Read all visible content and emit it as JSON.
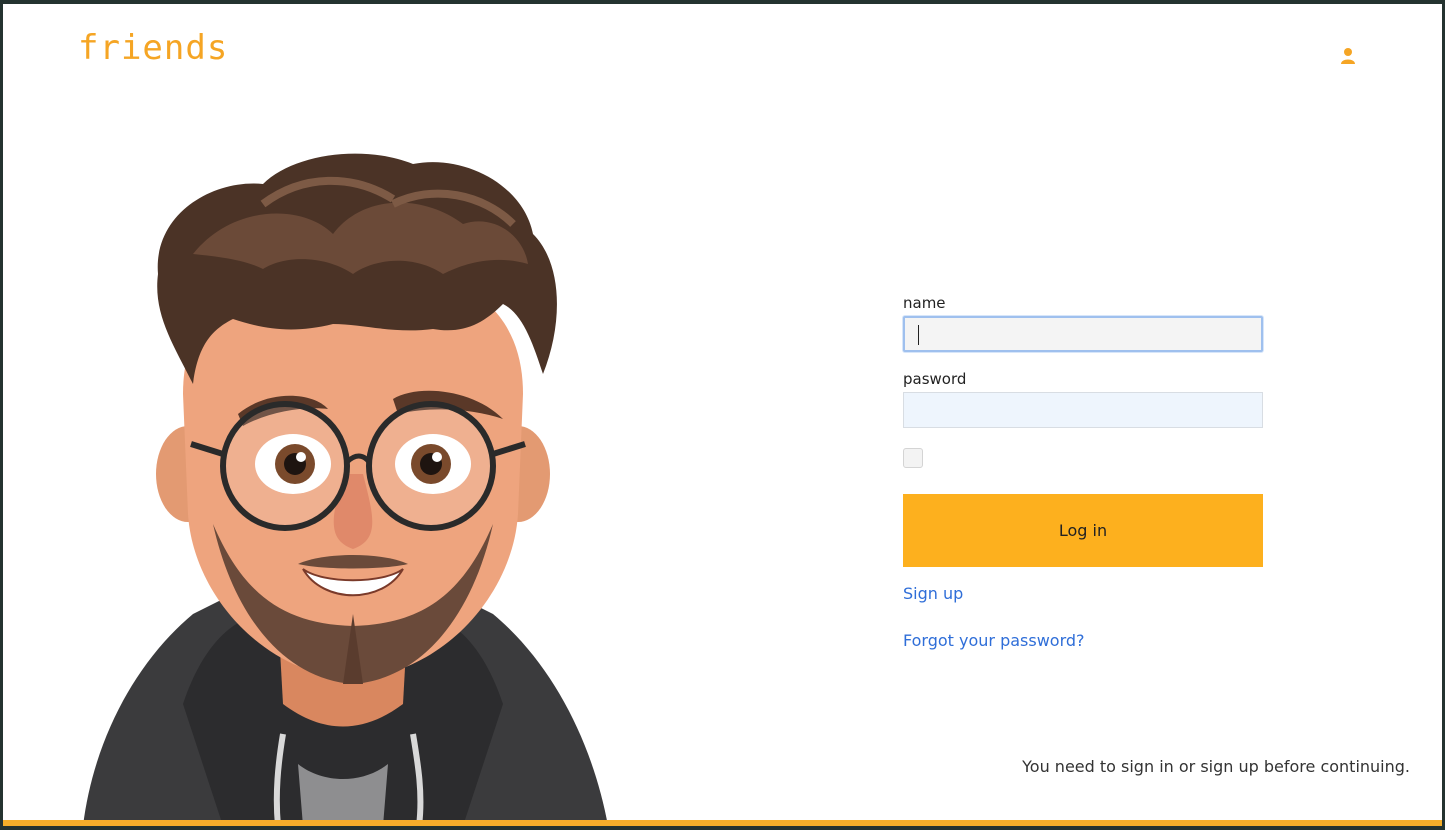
{
  "brand": {
    "logo": "friends",
    "accent": "#f5a524"
  },
  "header": {
    "icon": "user-icon"
  },
  "form": {
    "name_label": "name",
    "name_value": "",
    "password_label": "pasword",
    "password_value": "",
    "remember_checked": false,
    "submit_label": "Log in",
    "submit_color": "#fdb01e",
    "signup_link": "Sign up",
    "forgot_link": "Forgot your password?",
    "link_color": "#2f6ed8"
  },
  "notice": "You need to sign in or sign up before continuing.",
  "illustration": {
    "icon": "avatar-illustration"
  }
}
